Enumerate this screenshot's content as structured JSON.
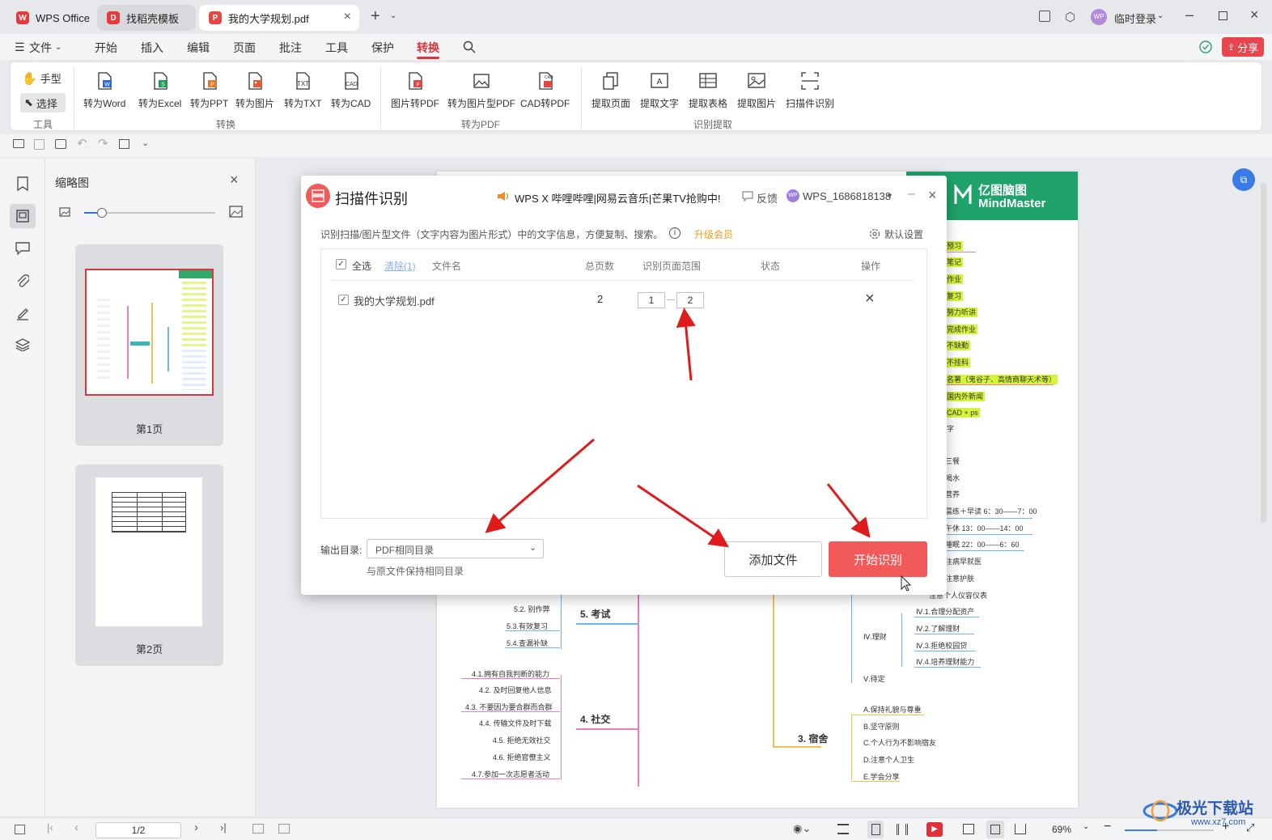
{
  "tabs": [
    {
      "label": "WPS Office"
    },
    {
      "label": "找稻壳模板"
    },
    {
      "label": "我的大学规划.pdf"
    }
  ],
  "titlebar": {
    "login": "临时登录",
    "avatar": "WP"
  },
  "menu": {
    "file": "文件",
    "items": [
      "开始",
      "插入",
      "编辑",
      "页面",
      "批注",
      "工具",
      "保护",
      "转换"
    ],
    "share": "分享"
  },
  "ribbon": {
    "tools": {
      "hand": "手型",
      "select": "选择",
      "group": "工具"
    },
    "convert": {
      "items": [
        "转为Word",
        "转为Excel",
        "转为PPT",
        "转为图片",
        "转为TXT",
        "转为CAD"
      ],
      "group": "转换"
    },
    "to_pdf": {
      "items": [
        "图片转PDF",
        "转为图片型PDF",
        "CAD转PDF"
      ],
      "group": "转为PDF"
    },
    "extract": {
      "items": [
        "提取页面",
        "提取文字",
        "提取表格",
        "提取图片",
        "扫描件识别"
      ],
      "group": "识别提取"
    }
  },
  "thumbnails": {
    "title": "缩略图",
    "pages": [
      "第1页",
      "第2页"
    ]
  },
  "dialog": {
    "title": "扫描件识别",
    "promo": "WPS X 哔哩哔哩|网易云音乐|芒果TV抢购中!",
    "feedback": "反馈",
    "user": "WPS_1686818138",
    "description": "识别扫描/图片型文件（文字内容为图片形式）中的文字信息，方便复制、搜索。",
    "upgrade": "升级会员",
    "default_settings": "默认设置",
    "table": {
      "select_all": "全选",
      "clear": "清除(1)",
      "col_name": "文件名",
      "col_pages": "总页数",
      "col_range": "识别页面范围",
      "col_status": "状态",
      "col_action": "操作",
      "rows": [
        {
          "name": "我的大学规划.pdf",
          "pages": "2",
          "from": "1",
          "to": "2"
        }
      ]
    },
    "output_label": "输出目录:",
    "output_value": "PDF相同目录",
    "output_hint": "与原文件保持相同目录",
    "add_file": "添加文件",
    "start": "开始识别"
  },
  "mindmap": {
    "brand_cn": "亿图脑图",
    "brand_en": "MindMaster",
    "right_items": [
      "预习",
      "笔记",
      "作业",
      "复习",
      "努力听讲",
      "完成作业",
      "不缺勤",
      "不挂科",
      "名著（鬼谷子、高情商聊天术等）",
      "国内外新闻",
      "CAD + ps",
      "三餐",
      "喝水",
      "营养",
      "晨练＋早读 6：30——7：00",
      "午休 13：00——14：00",
      "睡眠 22：00——6：60",
      "注病早就医",
      "注意护肤",
      "注意个人仪容仪表"
    ],
    "finance": [
      "Ⅳ.1.合理分配资产",
      "Ⅳ.2.了解理财",
      "Ⅳ.3.拒绝校园贷",
      "Ⅳ.4.培养理财能力"
    ],
    "finance_label": "Ⅳ.理财",
    "wait_label": "Ⅴ.待定",
    "dorm_label": "3. 宿舍",
    "dorm_items": [
      "A.保持礼貌与尊重",
      "B.坚守原则",
      "C.个人行为不影响宿友",
      "D.注意个人卫生",
      "E.学会分享"
    ],
    "exam_label": "5. 考试",
    "exam_items": [
      "5.2. 别作弊",
      "5.3.有效复习",
      "5.4.查漏补缺"
    ],
    "social_label": "4. 社交",
    "social_items": [
      "4.1.拥有自我判断的能力",
      "4.2. 及时回复他人信息",
      "4.3. 不要因为要合群而合群",
      "4.4. 传输文件及时下载",
      "4.5. 拒绝无效社交",
      "4.6. 拒绝官僚主义",
      "4.7.参加一次志愿者活动"
    ]
  },
  "statusbar": {
    "page": "1/2",
    "zoom": "69%"
  },
  "watermark": {
    "cn": "极光下载站",
    "en": "www.xz7.com"
  }
}
